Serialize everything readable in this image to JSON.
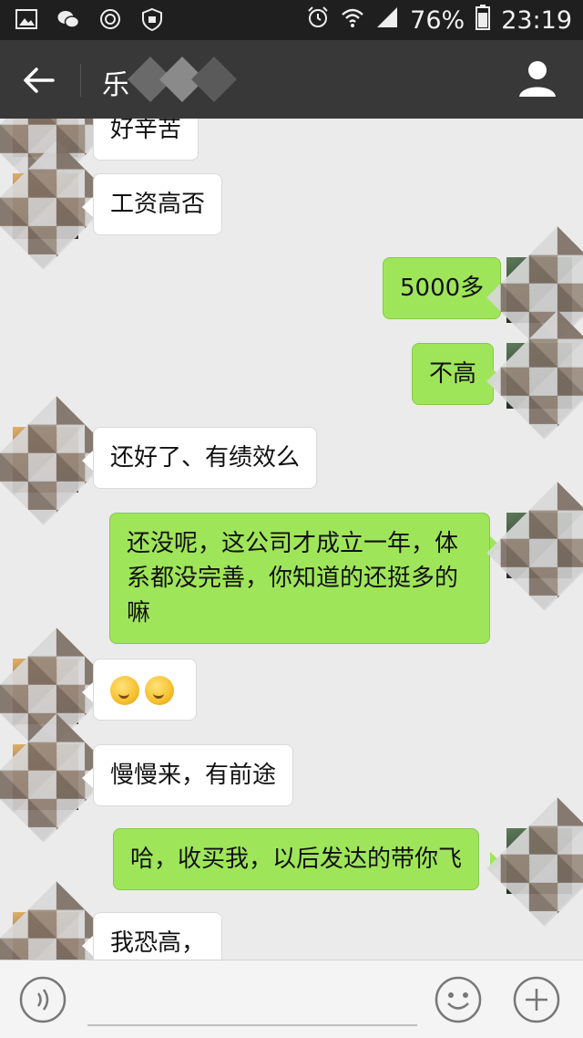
{
  "status_bar": {
    "battery": "76%",
    "time": "23:19"
  },
  "title_bar": {
    "title_visible": "乐",
    "back_icon": "arrow-left-icon",
    "profile_icon": "person-icon"
  },
  "messages": [
    {
      "side": "in",
      "text": "好辛苦"
    },
    {
      "side": "in",
      "text": "工资高否"
    },
    {
      "side": "out",
      "text": "5000多"
    },
    {
      "side": "out",
      "text": "不高"
    },
    {
      "side": "in",
      "text": "还好了、有绩效么"
    },
    {
      "side": "out",
      "text": "还没呢，这公司才成立一年，体系都没完善，你知道的还挺多的嘛"
    },
    {
      "side": "in",
      "text": "",
      "emoji": "thinking-face-icon x2"
    },
    {
      "side": "in",
      "text": "慢慢来，有前途"
    },
    {
      "side": "out",
      "text": "哈，收买我，以后发达的带你飞"
    },
    {
      "side": "in",
      "text": "我恐高，"
    }
  ],
  "input_bar": {
    "value": "",
    "voice_icon": "voice-icon",
    "emoji_icon": "smiley-icon",
    "more_icon": "plus-icon"
  },
  "colors": {
    "status_bar_bg": "#1f1f1f",
    "title_bar_bg": "#383838",
    "chat_bg": "#ebebeb",
    "outgoing_bubble": "#9fe55a",
    "incoming_bubble": "#ffffff"
  }
}
